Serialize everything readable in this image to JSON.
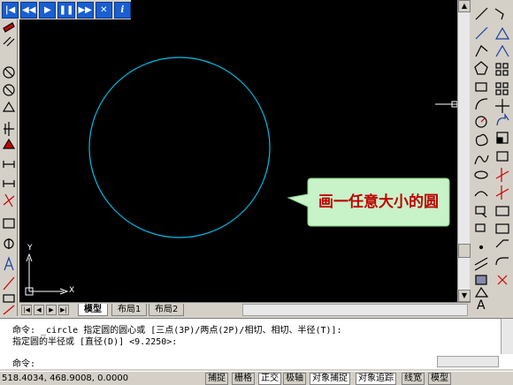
{
  "player_buttons": [
    {
      "icon": "skip-back-icon",
      "glyph": "|◀"
    },
    {
      "icon": "rewind-icon",
      "glyph": "◀◀"
    },
    {
      "icon": "play-icon",
      "glyph": "▶"
    },
    {
      "icon": "pause-icon",
      "glyph": "❚❚"
    },
    {
      "icon": "fast-forward-icon",
      "glyph": "▶▶"
    },
    {
      "icon": "close-icon",
      "glyph": "✕"
    },
    {
      "icon": "info-icon",
      "glyph": "i"
    }
  ],
  "callout": {
    "text": "画一任意大小的圆"
  },
  "ucs": {
    "x_label": "X",
    "y_label": "Y"
  },
  "tabs": {
    "model": "模型",
    "layout1": "布局1",
    "layout2": "布局2"
  },
  "command": {
    "line1": "命令: _circle 指定圆的圆心或 [三点(3P)/两点(2P)/相切、相切、半径(T)]:",
    "line2": "指定圆的半径或 [直径(D)] <9.2250>:",
    "line3": "命令:"
  },
  "status": {
    "coords": "518.4034, 468.9008, 0.0000",
    "buttons": [
      "捕捉",
      "栅格",
      "正交",
      "极轴",
      "对象捕捉",
      "对象追踪",
      "线宽",
      "模型"
    ]
  },
  "colors": {
    "circle": "#00b8e0",
    "callout_fill": "#c8f2c8",
    "callout_text": "#c00000",
    "canvas": "#000000"
  }
}
